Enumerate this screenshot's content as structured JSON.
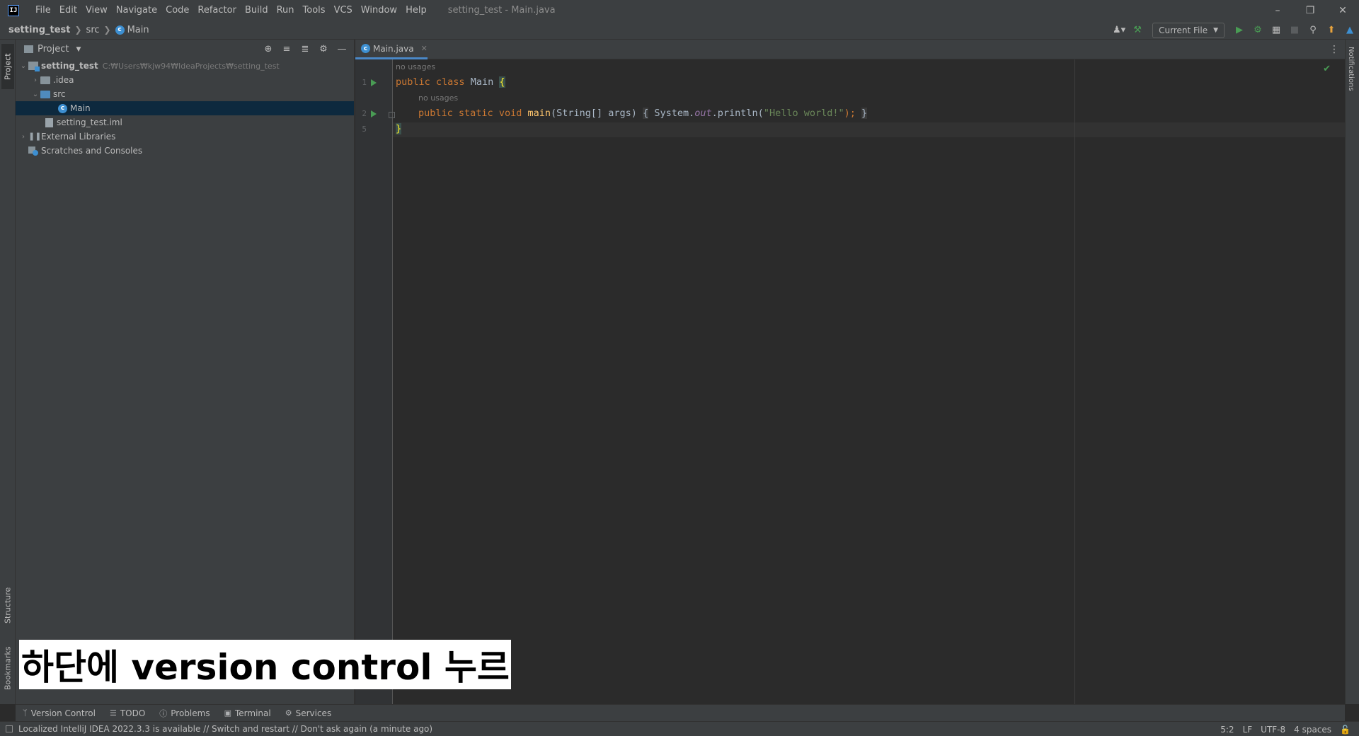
{
  "menubar": {
    "app_logo": "IJ",
    "items": [
      "File",
      "Edit",
      "View",
      "Navigate",
      "Code",
      "Refactor",
      "Build",
      "Run",
      "Tools",
      "VCS",
      "Window",
      "Help"
    ],
    "window_title": "setting_test - Main.java"
  },
  "navbar": {
    "breadcrumb": [
      "setting_test",
      "src",
      "Main"
    ],
    "run_config": "Current File"
  },
  "left_stripe": {
    "project": "Project",
    "structure": "Structure",
    "bookmarks": "Bookmarks"
  },
  "project_panel": {
    "title": "Project",
    "tree": {
      "root": "setting_test",
      "root_path": "C:₩Users₩kjw94₩IdeaProjects₩setting_test",
      "idea": ".idea",
      "src": "src",
      "main": "Main",
      "iml": "setting_test.iml",
      "libs": "External Libraries",
      "scratches": "Scratches and Consoles"
    }
  },
  "editor": {
    "tab": "Main.java",
    "hint_usages": "no usages",
    "line_numbers": [
      "1",
      "2",
      "5"
    ],
    "code": {
      "kw_public": "public",
      "kw_class": "class",
      "class_name": "Main",
      "open_brace": "{",
      "kw_static": "static",
      "kw_void": "void",
      "method": "main",
      "params": "(String[] args)",
      "system": "System.",
      "out": "out",
      "println": ".println(",
      "string": "\"Hello world!\"",
      "end": ");",
      "close_brace": "}"
    }
  },
  "right_stripe": {
    "notifications": "Notifications"
  },
  "bottom_bar": {
    "tabs": [
      "Version Control",
      "TODO",
      "Problems",
      "Terminal",
      "Services"
    ]
  },
  "status_bar": {
    "message": "Localized IntelliJ IDEA 2022.3.3 is available // Switch and restart // Don't ask again (a minute ago)",
    "position": "5:2",
    "line_sep": "LF",
    "encoding": "UTF-8",
    "indent": "4 spaces"
  },
  "caption": "하단에 version control 누르기",
  "colors": {
    "accent": "#4a88c7",
    "run_green": "#499c54",
    "selection": "#0d293e"
  }
}
